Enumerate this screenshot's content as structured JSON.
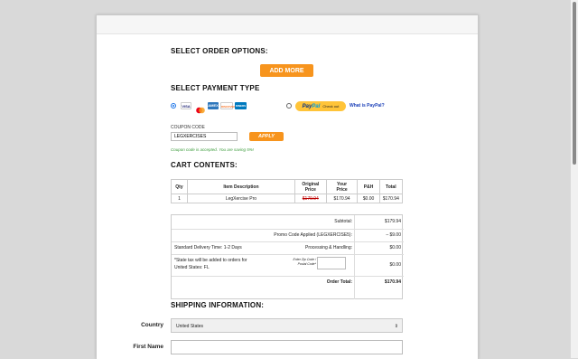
{
  "options": {
    "title": "SELECT ORDER OPTIONS:",
    "add_more_label": "ADD MORE"
  },
  "payment": {
    "title": "SELECT PAYMENT TYPE",
    "cards": [
      "VISA",
      "MC",
      "AMEX",
      "DISCOVER",
      "DINERS"
    ],
    "paypal_brand_1": "Pay",
    "paypal_brand_2": "Pal",
    "paypal_checkout": "Check out",
    "paypal_link": "What is PayPal?"
  },
  "coupon": {
    "label": "COUPON CODE",
    "value": "LEGXERCISES",
    "apply_label": "APPLY",
    "message": "Coupon code is accepted. You are saving 5%!"
  },
  "cart": {
    "title": "CART CONTENTS:",
    "headers": {
      "qty": "Qty",
      "desc": "Item Description",
      "orig_1": "Original",
      "orig_2": "Price",
      "your_1": "Your",
      "your_2": "Price",
      "ph": "P&H",
      "total": "Total"
    },
    "row": {
      "qty": "1",
      "desc": "LegXercise Pro",
      "orig": "$179.94",
      "your": "$170.94",
      "ph": "$0.00",
      "total": "$170.94"
    }
  },
  "summary": {
    "subtotal_label": "Subtotal:",
    "subtotal_value": "$179.94",
    "promo_label": "Promo Code Applied (LEGXERCISE5):",
    "promo_value": "– $9.00",
    "delivery_label": "Standard Delivery Time: 1-2 Days",
    "handling_label": "Processing & Handling:",
    "handling_value": "$0.00",
    "tax_note_1": "*State tax will be added to orders for",
    "tax_note_2": "United States: FL",
    "zip_label_1": "Enter Zip Code /",
    "zip_label_2": "Postal Code*",
    "tax_value": "$0.00",
    "order_total_label": "Order Total:",
    "order_total_value": "$170.94"
  },
  "shipping": {
    "title": "SHIPPING INFORMATION:",
    "country_label": "Country",
    "country_value": "United States",
    "first_name_label": "First Name"
  }
}
